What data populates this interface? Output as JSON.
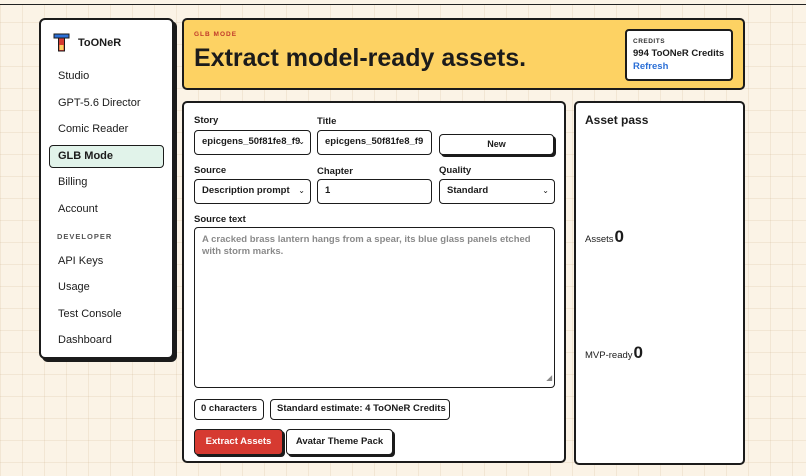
{
  "sidebar": {
    "brand": "ToONeR",
    "items": [
      {
        "label": "Studio"
      },
      {
        "label": "GPT-5.6 Director"
      },
      {
        "label": "Comic Reader"
      },
      {
        "label": "GLB Mode",
        "active": true
      },
      {
        "label": "Billing"
      },
      {
        "label": "Account"
      }
    ],
    "developer_section": "DEVELOPER",
    "developer_items": [
      {
        "label": "API Keys"
      },
      {
        "label": "Usage"
      },
      {
        "label": "Test Console"
      },
      {
        "label": "Dashboard"
      }
    ]
  },
  "banner": {
    "kicker": "GLB MODE",
    "title": "Extract model-ready assets.",
    "credits_label": "CREDITS",
    "credits_amount": "994 ToONeR Credits",
    "refresh_label": "Refresh"
  },
  "form": {
    "story_label": "Story",
    "story_value": "epicgens_50f81fe8_f9",
    "title_label": "Title",
    "title_value": "epicgens_50f81fe8_f9",
    "new_button": "New",
    "source_label": "Source",
    "source_value": "Description prompt",
    "chapter_label": "Chapter",
    "chapter_value": "1",
    "quality_label": "Quality",
    "quality_value": "Standard",
    "source_text_label": "Source text",
    "source_text_placeholder": "A cracked brass lantern hangs from a spear, its blue glass panels etched with storm marks.",
    "char_count": "0 characters",
    "estimate": "Standard estimate: 4 ToONeR Credits",
    "extract_button": "Extract Assets",
    "avatar_button": "Avatar Theme Pack"
  },
  "asset_pass": {
    "title": "Asset pass",
    "assets_label": "Assets",
    "assets_value": "0",
    "mvp_label": "MVP-ready",
    "mvp_value": "0"
  },
  "colors": {
    "banner": "#fdd263",
    "accent_red": "#d63a31",
    "kicker": "#c0392b",
    "link": "#2b6fd6",
    "active_nav": "#e1f3ea"
  }
}
